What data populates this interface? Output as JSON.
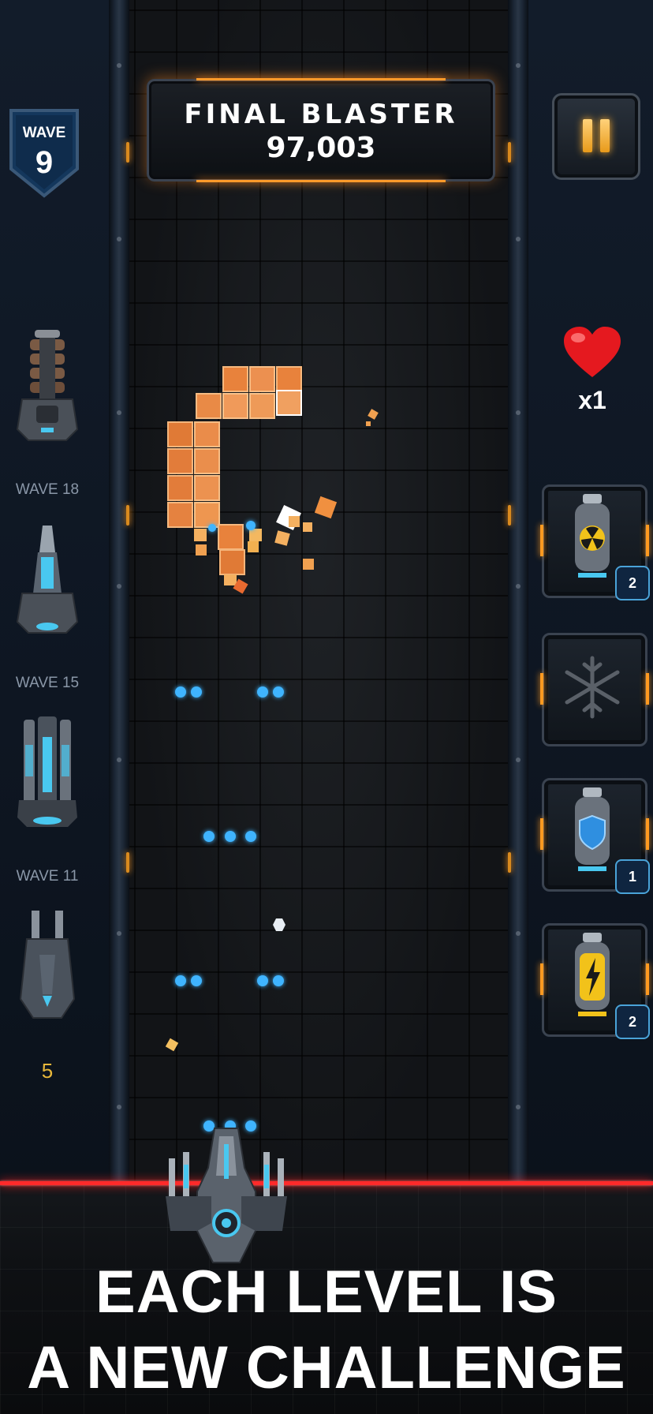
{
  "score_panel": {
    "title": "FINAL BLASTER",
    "score": "97,003"
  },
  "wave_badge": {
    "label": "WAVE",
    "number": "9"
  },
  "weapons": [
    {
      "icon": "cannon-tier-1-icon",
      "unlock_label": "WAVE 18"
    },
    {
      "icon": "cannon-tier-2-icon",
      "unlock_label": "WAVE 15"
    },
    {
      "icon": "cannon-tier-3-icon",
      "unlock_label": "WAVE 11"
    },
    {
      "icon": "cannon-tier-4-icon",
      "unlock_label": "5"
    }
  ],
  "lives": {
    "icon": "heart-icon",
    "count": "x1"
  },
  "powerups": [
    {
      "icon": "nuke-canister-icon",
      "quantity": "2"
    },
    {
      "icon": "freeze-snowflake-icon",
      "quantity": ""
    },
    {
      "icon": "shield-canister-icon",
      "quantity": "1"
    },
    {
      "icon": "lightning-canister-icon",
      "quantity": "2"
    }
  ],
  "tagline": {
    "line1": "EACH LEVEL IS",
    "line2": "A NEW CHALLENGE"
  },
  "colors": {
    "accent_orange": "#ff9a2a",
    "bullet_blue": "#3fb4ff",
    "laser_red": "#ff2a2a",
    "brick_orange": "#e8823c",
    "cost_gold": "#e8b73a"
  }
}
